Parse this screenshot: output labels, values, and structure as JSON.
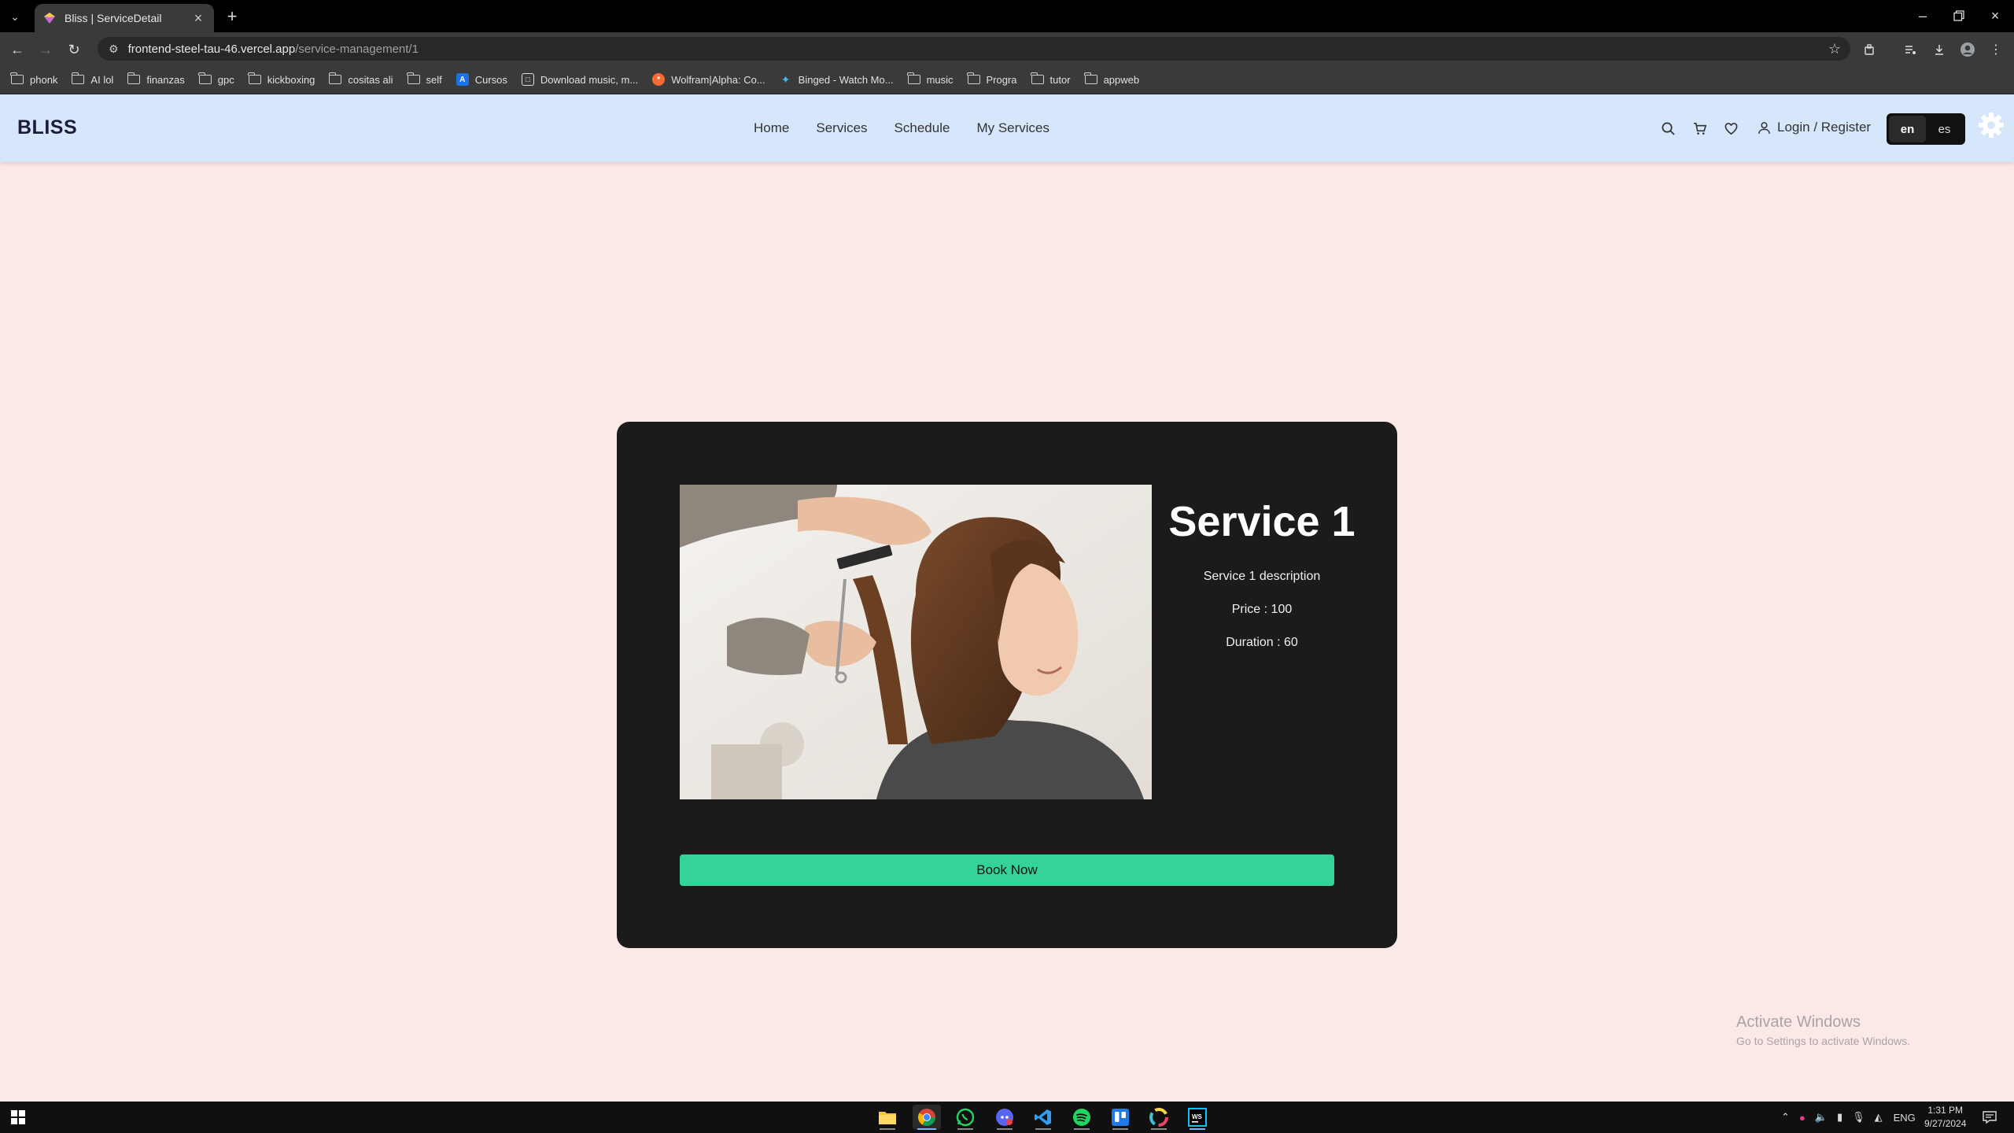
{
  "browser": {
    "tab_title": "Bliss | ServiceDetail",
    "url_host": "frontend-steel-tau-46.vercel.app",
    "url_path": "/service-management/1",
    "bookmarks": [
      {
        "label": "phonk",
        "icon": "folder-icon"
      },
      {
        "label": "AI lol",
        "icon": "folder-icon"
      },
      {
        "label": "finanzas",
        "icon": "folder-icon"
      },
      {
        "label": "gpc",
        "icon": "folder-icon"
      },
      {
        "label": "kickboxing",
        "icon": "folder-icon"
      },
      {
        "label": "cositas ali",
        "icon": "folder-icon"
      },
      {
        "label": "self",
        "icon": "folder-icon"
      },
      {
        "label": "Cursos",
        "icon": "site-icon"
      },
      {
        "label": "Download music, m...",
        "icon": "site-icon"
      },
      {
        "label": "Wolfram|Alpha: Co...",
        "icon": "site-icon"
      },
      {
        "label": "Binged - Watch Mo...",
        "icon": "site-icon"
      },
      {
        "label": "music",
        "icon": "folder-icon"
      },
      {
        "label": "Progra",
        "icon": "folder-icon"
      },
      {
        "label": "tutor",
        "icon": "folder-icon"
      },
      {
        "label": "appweb",
        "icon": "folder-icon"
      }
    ]
  },
  "header": {
    "logo": "BLISS",
    "nav": [
      "Home",
      "Services",
      "Schedule",
      "My Services"
    ],
    "login_label": "Login / Register",
    "languages": [
      "en",
      "es"
    ],
    "active_language": "en",
    "colors": {
      "background": "#d6e6fb"
    }
  },
  "service": {
    "title": "Service 1",
    "description": "Service 1 description",
    "price": "Price : 100",
    "duration": "Duration : 60",
    "book_label": "Book Now",
    "colors": {
      "card": "#1b1b1b",
      "button": "#34d399",
      "page": "#fde8e8"
    }
  },
  "os": {
    "activate_title": "Activate Windows",
    "activate_subtitle": "Go to Settings to activate Windows.",
    "language": "ENG",
    "time": "1:31 PM",
    "date": "9/27/2024"
  }
}
